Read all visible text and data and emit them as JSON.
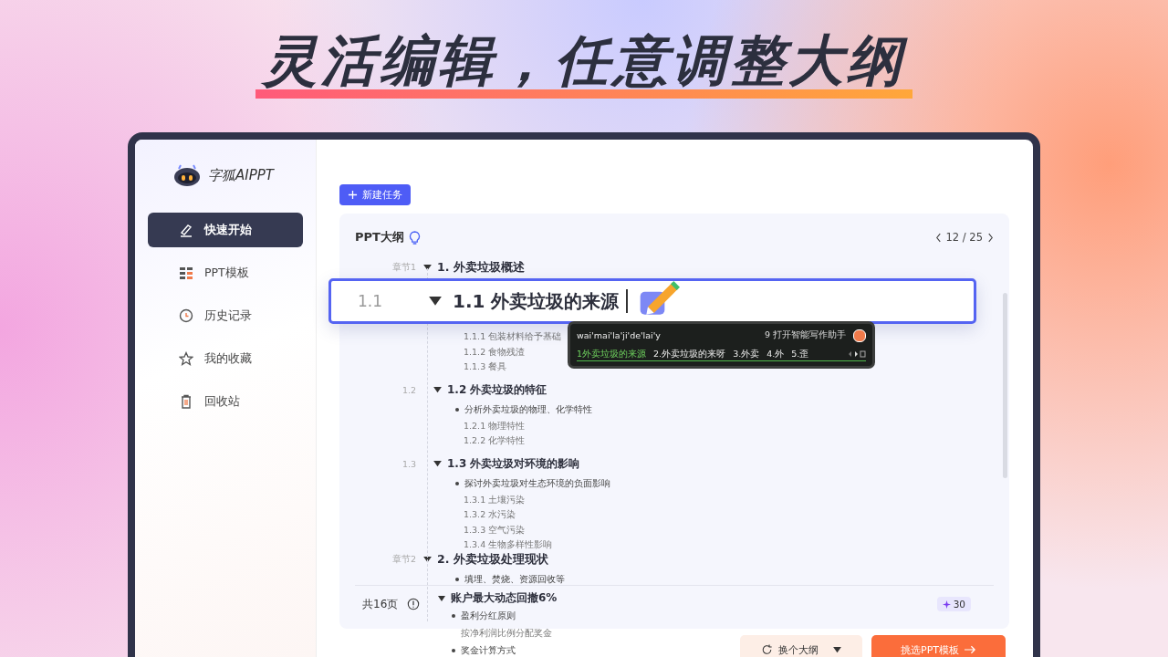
{
  "headline": "灵活编辑，任意调整大纲",
  "app": {
    "logo_text": "字狐AIPPT"
  },
  "sidebar": {
    "items": [
      {
        "label": "快速开始",
        "selected": true
      },
      {
        "label": "PPT模板",
        "selected": false
      },
      {
        "label": "历史记录",
        "selected": false
      },
      {
        "label": "我的收藏",
        "selected": false
      },
      {
        "label": "回收站",
        "selected": false
      }
    ]
  },
  "new_task_button": "新建任务",
  "outline": {
    "title": "PPT大纲",
    "pager": "12 / 25",
    "chapters": [
      {
        "label": "章节1",
        "title": "1. 外卖垃圾概述",
        "sections": [
          {
            "number": "1.1",
            "title": "1.1 外卖垃圾的来源",
            "focused": true,
            "items": [
              "1.1.1 包装材料给予基础",
              "1.1.2 食物残渣",
              "1.1.3 餐具"
            ]
          },
          {
            "number": "1.2",
            "title": "1.2 外卖垃圾的特征",
            "focused": false,
            "bullets": [
              "分析外卖垃圾的物理、化学特性"
            ],
            "items": [
              "1.2.1 物理特性",
              "1.2.2 化学特性"
            ]
          },
          {
            "number": "1.3",
            "title": "1.3 外卖垃圾对环境的影响",
            "focused": false,
            "bullets": [
              "探讨外卖垃圾对生态环境的负面影响"
            ],
            "items": [
              "1.3.1 土壤污染",
              "1.3.2 水污染",
              "1.3.3 空气污染",
              "1.3.4 生物多样性影响"
            ]
          }
        ]
      },
      {
        "label": "章节2",
        "title": "2. 外卖垃圾处理现状",
        "bullets": [
          "填埋、焚烧、资源回收等"
        ]
      }
    ],
    "overflow_lines": [
      {
        "kind": "heading",
        "text": "账户最大动态回撤6%"
      },
      {
        "kind": "bullet",
        "text": "盈利分红原则"
      },
      {
        "kind": "sub",
        "text": "按净利润比例分配奖金"
      },
      {
        "kind": "bullet",
        "text": "奖金计算方式"
      }
    ],
    "page_count": "共16页",
    "credits": "30"
  },
  "ime": {
    "input": "wai'mai'la'ji'de'lai'y",
    "hint": "9 打开智能写作助手",
    "candidates": [
      {
        "text": "1外卖垃圾的来源",
        "selected": true
      },
      {
        "text": "2.外卖垃圾的来呀",
        "selected": false
      },
      {
        "text": "3.外卖",
        "selected": false
      },
      {
        "text": "4.外",
        "selected": false
      },
      {
        "text": "5.歪",
        "selected": false
      }
    ]
  },
  "buttons": {
    "regenerate": "换个大纲",
    "next": "挑选PPT模板"
  }
}
